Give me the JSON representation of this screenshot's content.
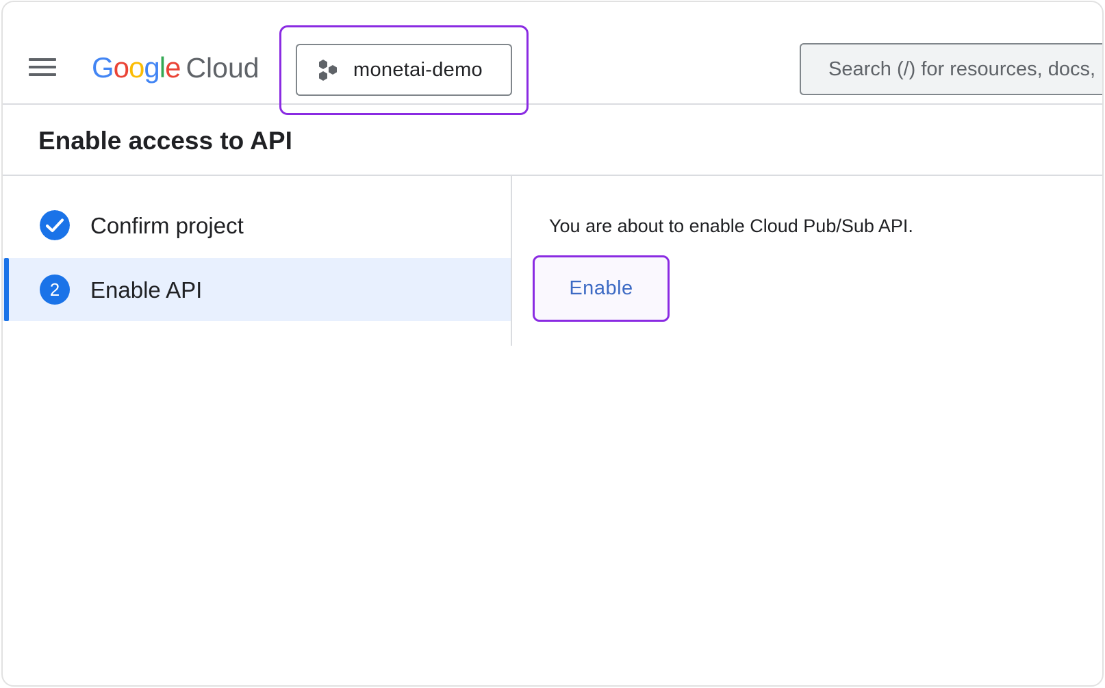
{
  "header": {
    "logo_google": [
      "G",
      "o",
      "o",
      "g",
      "l",
      "e"
    ],
    "logo_cloud": "Cloud",
    "project_name": "monetai-demo",
    "search_placeholder": "Search (/) for resources, docs,"
  },
  "page": {
    "title": "Enable access to API"
  },
  "steps": [
    {
      "label": "Confirm project",
      "status": "complete",
      "icon": "check-icon"
    },
    {
      "label": "Enable API",
      "number": "2",
      "status": "active"
    }
  ],
  "content": {
    "message": "You are about to enable Cloud Pub/Sub API.",
    "enable_label": "Enable"
  },
  "colors": {
    "accent_blue": "#1a73e8",
    "highlight_purple": "#8a2be2",
    "active_step_bg": "#e8f0fe",
    "logo_blue": "#4285f4",
    "logo_red": "#ea4335",
    "logo_yellow": "#fbbc04",
    "logo_green": "#34a853"
  }
}
